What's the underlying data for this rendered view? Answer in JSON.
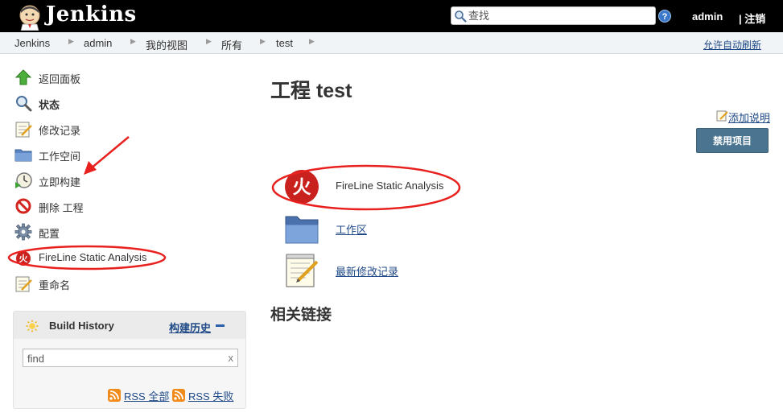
{
  "header": {
    "brand": "Jenkins",
    "search_placeholder": "查找",
    "help": "?",
    "user": "admin",
    "logout": "| 注销"
  },
  "breadcrumbs": {
    "items": [
      "Jenkins",
      "admin",
      "我的视图",
      "所有",
      "test"
    ],
    "auto_refresh": "允许自动刷新"
  },
  "sidebar": {
    "tasks": [
      {
        "label": "返回面板",
        "icon": "up-arrow-icon"
      },
      {
        "label": "状态",
        "icon": "magnifier-icon"
      },
      {
        "label": "修改记录",
        "icon": "notepad-icon"
      },
      {
        "label": "工作空间",
        "icon": "folder-icon"
      },
      {
        "label": "立即构建",
        "icon": "clock-play-icon"
      },
      {
        "label": "删除 工程",
        "icon": "no-entry-icon"
      },
      {
        "label": "配置",
        "icon": "gear-icon"
      },
      {
        "label": "FireLine Static Analysis",
        "icon": "fireline-icon"
      },
      {
        "label": "重命名",
        "icon": "notepad-icon"
      }
    ]
  },
  "build_history": {
    "title": "Build History",
    "trend_link": "构建历史",
    "filter_value": "find",
    "clear": "x",
    "rss_all": "RSS 全部",
    "rss_failed": "RSS 失败"
  },
  "main": {
    "title": "工程 test",
    "add_description": "添加说明",
    "disable_button": "禁用项目",
    "links": [
      {
        "label": "FireLine Static Analysis",
        "icon": "fireline-icon",
        "glyph": "火"
      },
      {
        "label": "工作区",
        "icon": "folder-icon"
      },
      {
        "label": "最新修改记录",
        "icon": "notepad-icon"
      }
    ],
    "related_title": "相关链接"
  },
  "colors": {
    "header_bg": "#000000",
    "link": "#204a87",
    "button_bg": "#4a7490",
    "annotation_red": "#e8211f",
    "fireline_red": "#c9211e"
  }
}
